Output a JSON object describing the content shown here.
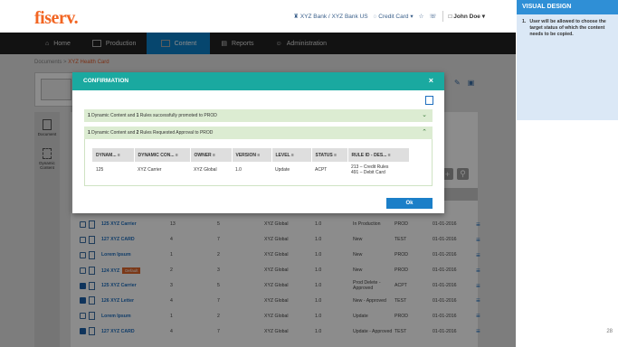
{
  "app": {
    "logo": "fiserv.",
    "top_right": {
      "bank": "XYZ Bank / XYZ Bank US",
      "product": "Credit Card",
      "user": "John Doe"
    },
    "nav": [
      {
        "label": "Home"
      },
      {
        "label": "Production"
      },
      {
        "label": "Content"
      },
      {
        "label": "Reports"
      },
      {
        "label": "Administration"
      }
    ],
    "breadcrumb": {
      "root": "Documents",
      "sep": ">",
      "current": "XYZ Health Card"
    },
    "left_items": [
      {
        "label": "Document"
      },
      {
        "label": "Dynamic Content"
      }
    ]
  },
  "rows": [
    {
      "checked": false,
      "name": "125 XYZ Carrier",
      "badge": "",
      "c1": "13",
      "c2": "5",
      "owner": "XYZ Global",
      "ver": "1.0",
      "status": "In Production",
      "env": "PROD",
      "date": "01-01-2016"
    },
    {
      "checked": false,
      "name": "127 XYZ CARD",
      "badge": "",
      "c1": "4",
      "c2": "7",
      "owner": "XYZ Global",
      "ver": "1.0",
      "status": "New",
      "env": "TEST",
      "date": "01-01-2016"
    },
    {
      "checked": false,
      "name": "Lorem Ipsum",
      "badge": "",
      "c1": "1",
      "c2": "2",
      "owner": "XYZ Global",
      "ver": "1.0",
      "status": "New",
      "env": "PROD",
      "date": "01-01-2016"
    },
    {
      "checked": false,
      "name": "124 XYZ",
      "badge": "Default",
      "c1": "2",
      "c2": "3",
      "owner": "XYZ Global",
      "ver": "1.0",
      "status": "New",
      "env": "PROD",
      "date": "01-01-2016"
    },
    {
      "checked": true,
      "name": "125 XYZ Carrier",
      "badge": "",
      "c1": "3",
      "c2": "5",
      "owner": "XYZ Global",
      "ver": "1.0",
      "status": "Prod Delete - Approved",
      "env": "ACPT",
      "date": "01-01-2016"
    },
    {
      "checked": true,
      "name": "126 XYZ Letter",
      "badge": "",
      "c1": "4",
      "c2": "7",
      "owner": "XYZ Global",
      "ver": "1.0",
      "status": "New - Approved",
      "env": "TEST",
      "date": "01-01-2016"
    },
    {
      "checked": false,
      "name": "Lorem Ipsum",
      "badge": "",
      "c1": "1",
      "c2": "2",
      "owner": "XYZ Global",
      "ver": "1.0",
      "status": "Update",
      "env": "PROD",
      "date": "01-01-2016"
    },
    {
      "checked": true,
      "name": "127 XYZ CARD",
      "badge": "",
      "c1": "4",
      "c2": "7",
      "owner": "XYZ Global",
      "ver": "1.0",
      "status": "Update - Approved",
      "env": "TEST",
      "date": "01-01-2016"
    }
  ],
  "modal": {
    "title": "CONFIRMATION",
    "close": "×",
    "acc1": {
      "n1": "1",
      "t1": " Dynamic Content and ",
      "n2": "1",
      "t2": " Rules successfully promoted to PROD"
    },
    "acc2": {
      "n1": "1",
      "t1": " Dynamic Content and ",
      "n2": "2",
      "t2": " Rules Requested Approval to PROD"
    },
    "columns": [
      "DYNAM...",
      "DYNAMIC CON...",
      "OWNER",
      "VERSION",
      "LEVEL",
      "STATUS",
      "RULE ID - DES..."
    ],
    "row": {
      "id": "125",
      "name": "XYZ Carrier",
      "owner": "XYZ Global",
      "version": "1.0",
      "level": "Update",
      "status": "ACPT",
      "rules1": "213 – Credit Rules",
      "rules2": "491 – Debit Card"
    },
    "ok": "Ok"
  },
  "panel": {
    "title": "VISUAL DESIGN",
    "num": "1.",
    "note": "User will be allowed to choose the target status of which the content needs to be copied."
  },
  "page_number": "28",
  "colors": {
    "accent": "#0b80c8",
    "modal_header": "#1aa9a0",
    "brand": "#f26522",
    "panel_header": "#2f8fd6"
  }
}
